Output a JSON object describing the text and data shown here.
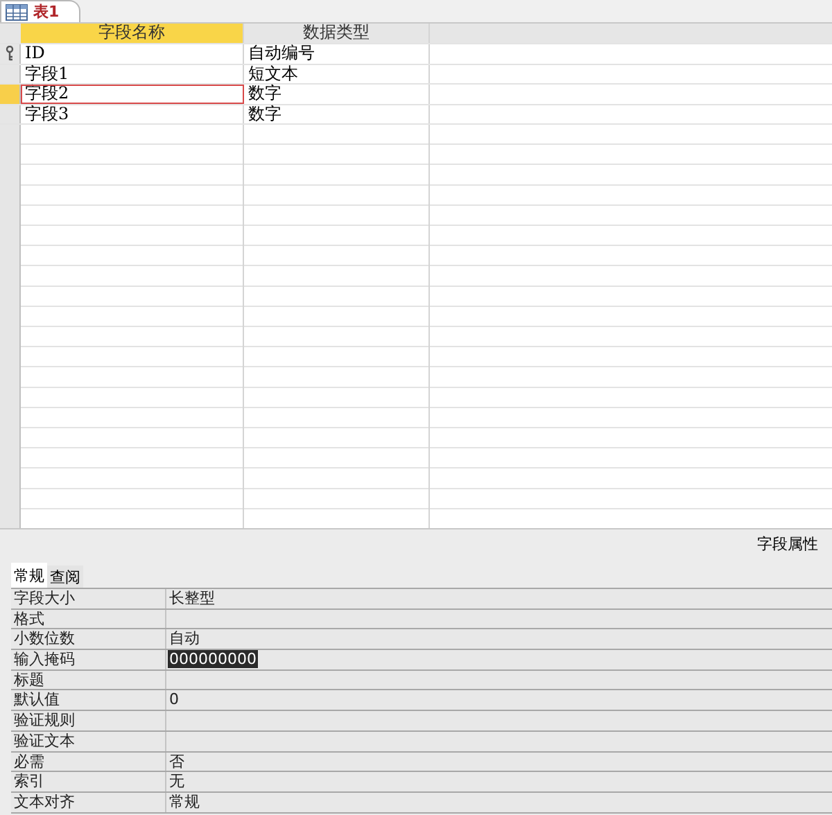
{
  "document_tab": {
    "title": "表1"
  },
  "design_grid": {
    "columns": [
      {
        "label": "字段名称",
        "selected": true
      },
      {
        "label": "数据类型",
        "selected": false
      }
    ],
    "rows": [
      {
        "name": "ID",
        "type": "自动编号",
        "primary_key": true,
        "selected": false
      },
      {
        "name": "字段1",
        "type": "短文本",
        "primary_key": false,
        "selected": false
      },
      {
        "name": "字段2",
        "type": "数字",
        "primary_key": false,
        "selected": true
      },
      {
        "name": "字段3",
        "type": "数字",
        "primary_key": false,
        "selected": false
      }
    ]
  },
  "field_properties": {
    "title": "字段属性",
    "tabs": [
      {
        "label": "常规",
        "selected": true
      },
      {
        "label": "查阅",
        "selected": false
      }
    ],
    "rows": [
      {
        "label": "字段大小",
        "value": "长整型",
        "selected": false
      },
      {
        "label": "格式",
        "selected": false
      },
      {
        "label": "小数位数",
        "value": "自动",
        "selected": false
      },
      {
        "label": "输入掩码",
        "value": "000000000",
        "selected": true
      },
      {
        "label": "标题",
        "selected": false
      },
      {
        "label": "默认值",
        "value": "0",
        "selected": false
      },
      {
        "label": "验证规则",
        "selected": false
      },
      {
        "label": "验证文本",
        "selected": false
      },
      {
        "label": "必需",
        "value": "否",
        "selected": false
      },
      {
        "label": "索引",
        "value": "无",
        "selected": false
      },
      {
        "label": "文本对齐",
        "value": "常规",
        "selected": false
      }
    ]
  }
}
